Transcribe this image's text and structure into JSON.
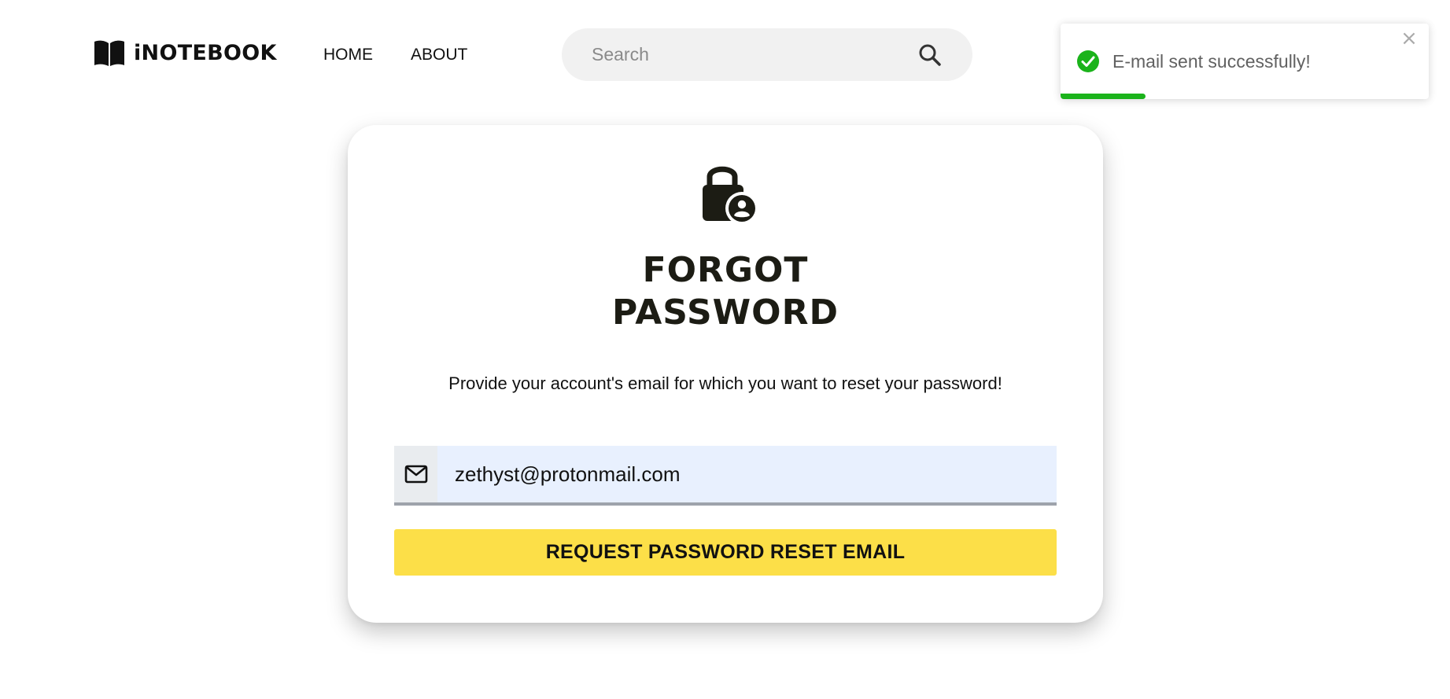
{
  "navbar": {
    "brand": "iNOTEBOOK",
    "brand_icon": "book-open-icon",
    "links": [
      {
        "label": "HOME"
      },
      {
        "label": "ABOUT"
      }
    ],
    "search": {
      "placeholder": "Search",
      "value": "",
      "icon": "search-icon"
    }
  },
  "card": {
    "icon": "lock-user-icon",
    "title_line1": "FORGOT",
    "title_line2": "PASSWORD",
    "subtitle": "Provide your account's email for which you want to reset your password!",
    "email": {
      "icon": "envelope-icon",
      "value": "zethyst@protonmail.com",
      "background": "#e8f0fe"
    },
    "submit_label": "REQUEST PASSWORD RESET EMAIL",
    "submit_color": "#fcdf48"
  },
  "toast": {
    "message": "E-mail sent successfully!",
    "icon": "check-circle-icon",
    "close_glyph": "×",
    "progress_fraction": 0.23,
    "accent": "#1bb31b"
  }
}
